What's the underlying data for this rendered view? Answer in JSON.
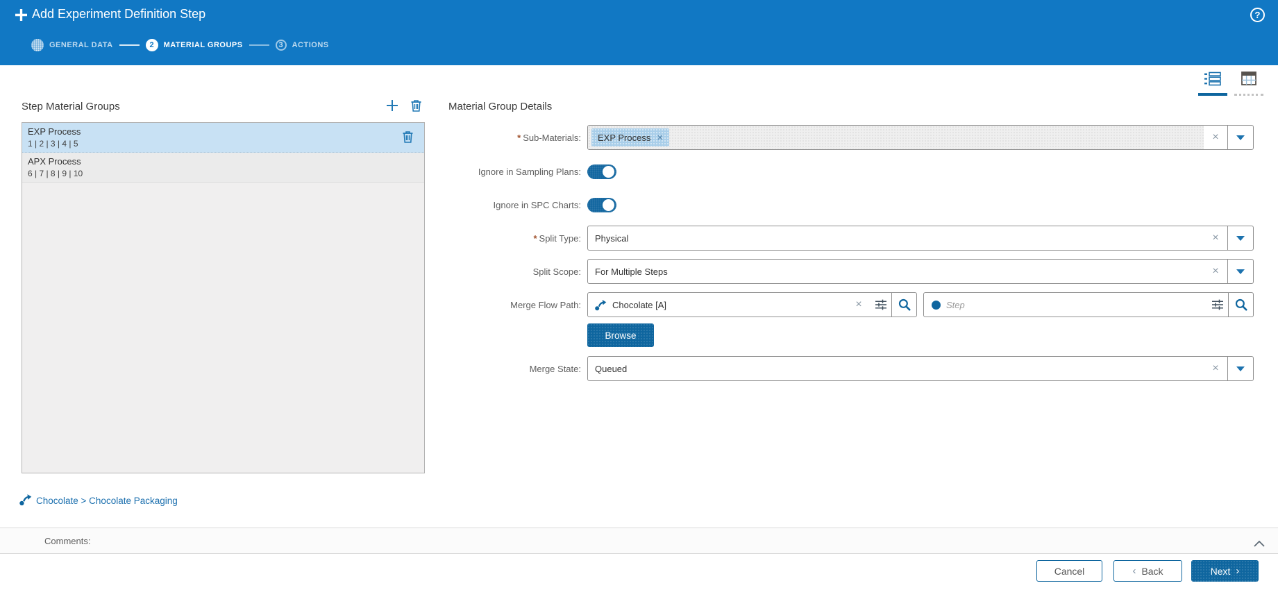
{
  "header": {
    "title": "Add Experiment Definition Step",
    "steps": [
      {
        "number": "",
        "label": "GENERAL DATA"
      },
      {
        "number": "2",
        "label": "MATERIAL GROUPS"
      },
      {
        "number": "3",
        "label": "ACTIONS"
      }
    ]
  },
  "left_panel": {
    "title": "Step Material Groups",
    "items": [
      {
        "title": "EXP Process",
        "subtitle": "1 | 2 | 3 | 4 | 5",
        "selected": true
      },
      {
        "title": "APX Process",
        "subtitle": "6 | 7 | 8 | 9 | 10",
        "selected": false
      }
    ]
  },
  "details": {
    "title": "Material Group Details",
    "required_marker": "*",
    "sub_materials": {
      "label": "Sub-Materials:",
      "chip": "EXP Process"
    },
    "ignore_sampling_plans": {
      "label": "Ignore in Sampling Plans:",
      "state": "on"
    },
    "ignore_spc_charts": {
      "label": "Ignore in SPC Charts:",
      "state": "on"
    },
    "split_type": {
      "label": "Split Type:",
      "value": "Physical"
    },
    "split_scope": {
      "label": "Split Scope:",
      "value": "For Multiple Steps"
    },
    "merge_flow_path": {
      "label": "Merge Flow Path:",
      "value": "Chocolate [A]",
      "step_placeholder": "Step"
    },
    "browse_button": "Browse",
    "merge_state": {
      "label": "Merge State:",
      "value": "Queued"
    }
  },
  "breadcrumb": {
    "label": "Chocolate > Chocolate Packaging"
  },
  "comments": {
    "label": "Comments:"
  },
  "footer": {
    "cancel": "Cancel",
    "back": "Back",
    "next": "Next"
  },
  "icons": {
    "clear": "×",
    "chip_remove": "×",
    "help": "?",
    "back_chevron": "‹",
    "next_chevron": "›"
  },
  "colors": {
    "header": "#1178c4",
    "accent": "#0f669f",
    "selected_item": "#c8e1f4",
    "link": "#1b6fae"
  }
}
